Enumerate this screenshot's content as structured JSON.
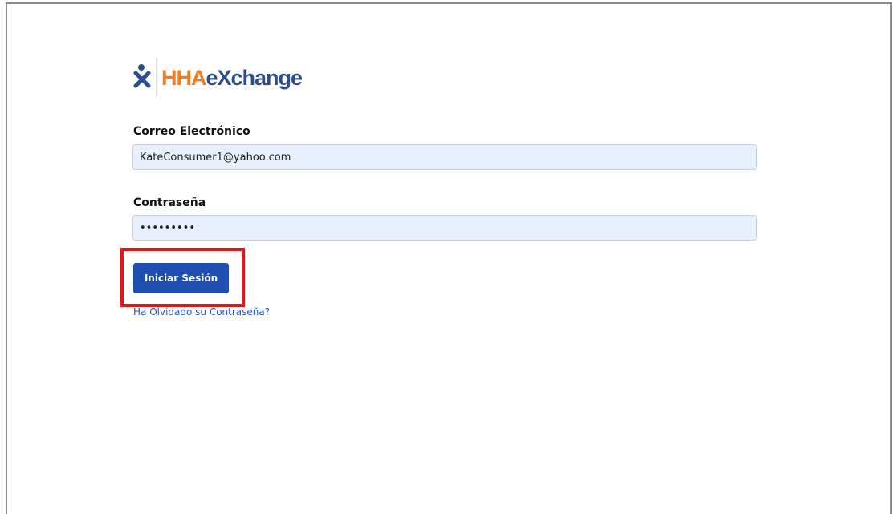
{
  "logo": {
    "icon_name": "person-x-icon",
    "text_hha": "HHA",
    "text_exchange": "eXchange",
    "colors": {
      "hha": "#f47c20",
      "exchange": "#2d4e8e"
    }
  },
  "form": {
    "email_label": "Correo Electrónico",
    "email_value": "KateConsumer1@yahoo.com",
    "password_label": "Contraseña",
    "password_value": "*********",
    "login_button_label": "Iniciar Sesión",
    "forgot_password_link": "Ha Olvidado su Contraseña?"
  },
  "colors": {
    "primary_button": "#1f4fb3",
    "link": "#2457c5",
    "input_background": "#e8f0fe",
    "highlight": "#e8141c"
  }
}
